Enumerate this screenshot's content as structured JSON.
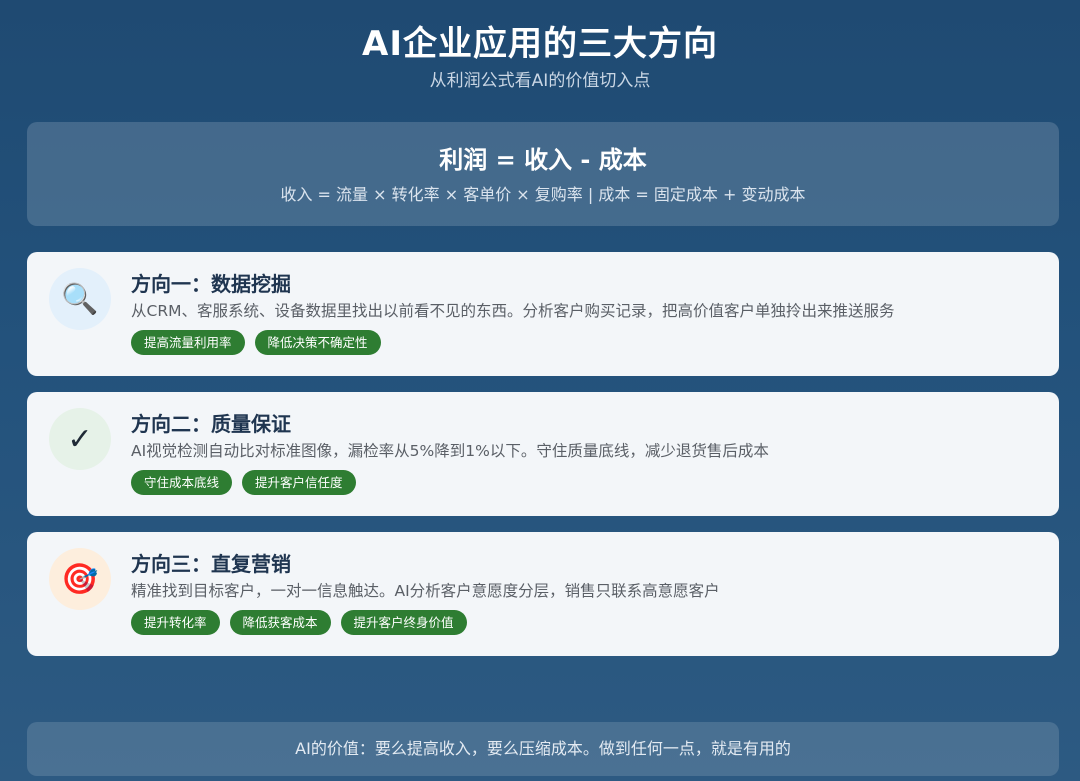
{
  "header": {
    "title": "AI企业应用的三大方向",
    "subtitle": "从利润公式看AI的价值切入点"
  },
  "formula": {
    "main": "利润 = 收入 - 成本",
    "detail": "收入 = 流量 × 转化率 × 客单价 × 复购率 | 成本 = 固定成本 + 变动成本"
  },
  "directions": [
    {
      "icon": "magnifier-icon",
      "icon_glyph": "🔍",
      "icon_bg": "#e3f0fb",
      "title": "方向一：数据挖掘",
      "desc": "从CRM、客服系统、设备数据里找出以前看不见的东西。分析客户购买记录，把高价值客户单独拎出来推送服务",
      "tags": [
        "提高流量利用率",
        "降低决策不确定性"
      ]
    },
    {
      "icon": "checkmark-icon",
      "icon_glyph": "✓",
      "icon_bg": "#e6f2e8",
      "title": "方向二：质量保证",
      "desc": "AI视觉检测自动比对标准图像，漏检率从5%降到1%以下。守住质量底线，减少退货售后成本",
      "tags": [
        "守住成本底线",
        "提升客户信任度"
      ]
    },
    {
      "icon": "target-icon",
      "icon_glyph": "🎯",
      "icon_bg": "#fdeedd",
      "title": "方向三：直复营销",
      "desc": "精准找到目标客户，一对一信息触达。AI分析客户意愿度分层，销售只联系高意愿客户",
      "tags": [
        "提升转化率",
        "降低获客成本",
        "提升客户终身价值"
      ]
    }
  ],
  "colors": {
    "tag_green": "#2e7d32",
    "card_title": "#1f3550",
    "background_top": "#1f4a72"
  },
  "footer": {
    "text": "AI的价值：要么提高收入，要么压缩成本。做到任何一点，就是有用的"
  }
}
